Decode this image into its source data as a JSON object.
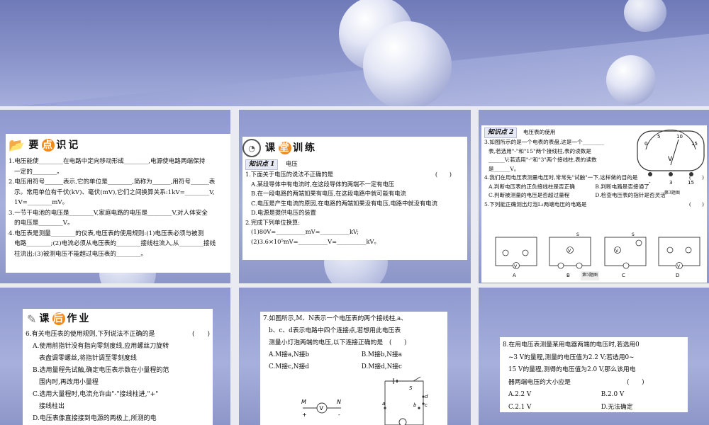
{
  "panel1": {
    "header": "要点识记",
    "header_highlight": "点",
    "lines": [
      "1.电压能使________在电路中定向移动形成________,电源使电路两端保持",
      "一定的________。",
      "2.电压用符号______表示,它的单位是________,简称为______,用符号______表",
      "示。常用单位有千伏(kV)、毫伏(mV),它们之间换算关系:1kV=________V,",
      "1V=________mV。",
      "3.一节干电池的电压是________V,家庭电路的电压是________V,对人体安全",
      "的电压是________V。",
      "4.电压表是测量________的仪表,电压表的使用规则:(1)电压表必须与被测",
      "电路________;(2)电流必须从电压表的________接线柱流入,从________接线",
      "柱流出;(3)被测电压不能超过电压表的________。"
    ]
  },
  "panel2": {
    "header": "课堂训练",
    "header_highlight": "堂",
    "tag": "知识点 1",
    "tag_title": "电压",
    "q1": "1.下面关于电压的说法不正确的是",
    "q1_paren": "(　　)",
    "q1_opts": [
      "A.某段导体中有电流时,在这段导体的两端不一定有电压",
      "B.在一段电路的两端如果有电压,在这段电路中就可能有电流",
      "C.电压是产生电流的原因,在电路的两端如果没有电压,电路中就没有电流",
      "D.电源是提供电压的装置"
    ],
    "q2": "2.完成下列单位换算:",
    "q2_lines": [
      "(1)80V=__________mV=__________kV;",
      "(2)3.6×10⁵mV=__________V=__________kV。"
    ]
  },
  "panel3": {
    "tag": "知识点 2",
    "tag_title": "电压表的使用",
    "q3_lines": [
      "3.如图所示的是一个电表的表盘,这是一个________",
      "表,若选用\"-\"和\"15\"两个接线柱,表的读数是",
      "______V;若选用\"-\"和\"3\"两个接线柱,表的读数",
      "是______V。"
    ],
    "meter_scale": [
      "0",
      "5",
      "10",
      "15"
    ],
    "meter_unit": "V",
    "meter_terminals": [
      "-",
      "3",
      "15"
    ],
    "meter_caption": "第3题图",
    "q4": "4.我们在用电压表测量电压时,常常先\"试触\"一下,这样做的目的是",
    "q4_paren": "(　　)",
    "q4_opts": [
      "A.判断电压表的正负接线柱是否正确",
      "B.判断电路是否接通了",
      "C.判断被测量的电压是否超过量程",
      "D.检查电压表的指针是否灵活"
    ],
    "q5": "5.下列能正确测出灯泡L₁两端电压的电路是",
    "q5_paren": "(　　)",
    "circuit_labels": [
      "A",
      "B",
      "C",
      "D"
    ],
    "circuit_caption": "第5题图",
    "circuit_symbol_v": "V",
    "circuit_symbol_s": "S",
    "circuit_l1": "L1",
    "circuit_l2": "L2"
  },
  "panel4": {
    "header": "课后作业",
    "header_highlight": "后",
    "q6": "6.有关电压表的使用规则,下列说法不正确的是",
    "q6_paren": "(　　)",
    "q6_lines": [
      "A.使用前指针没有指向零刻度线,应用螺丝刀旋转",
      "　表盘调零螺丝,将指针调至零刻度线",
      "B.选用量程先试触,确定电压表示数在小量程的范",
      "　围内时,再改用小量程",
      "C.选用大量程时,电流允许由\"-\"接线柱进,\"+\"",
      "　接线柱出",
      "D.电压表像直接接到电源的两极上,所测的电"
    ]
  },
  "panel5": {
    "q7_lines": [
      "7.如图所示,M、N表示一个电压表的两个接线柱,a、",
      "b、c、d表示电路中四个连接点,若想用此电压表",
      "测量小灯泡两端的电压,以下连接正确的是　(　　)"
    ],
    "q7_opts": [
      "A.M接a,N接b",
      "B.M接b,N接a",
      "C.M接c,N接d",
      "D.M接d,N接c"
    ],
    "labels": {
      "M": "M",
      "N": "N",
      "plus": "+",
      "minus": "-",
      "V": "V",
      "S": "S",
      "a": "a",
      "b": "b",
      "c": "c",
      "d": "d"
    }
  },
  "panel6": {
    "q8_lines": [
      "8.在用电压表测量某用电器两端的电压时,若选用0",
      "~3 V的量程,测量的电压值为2.2 V;若选用0~",
      "15 V的量程,测得的电压值为2.0 V,那么该用电",
      "器两端电压的大小应是　　　　　　　　　(　　)"
    ],
    "q8_opts": [
      "A.2.2 V",
      "B.2.0 V",
      "C.2.1 V",
      "D.无法确定"
    ]
  }
}
